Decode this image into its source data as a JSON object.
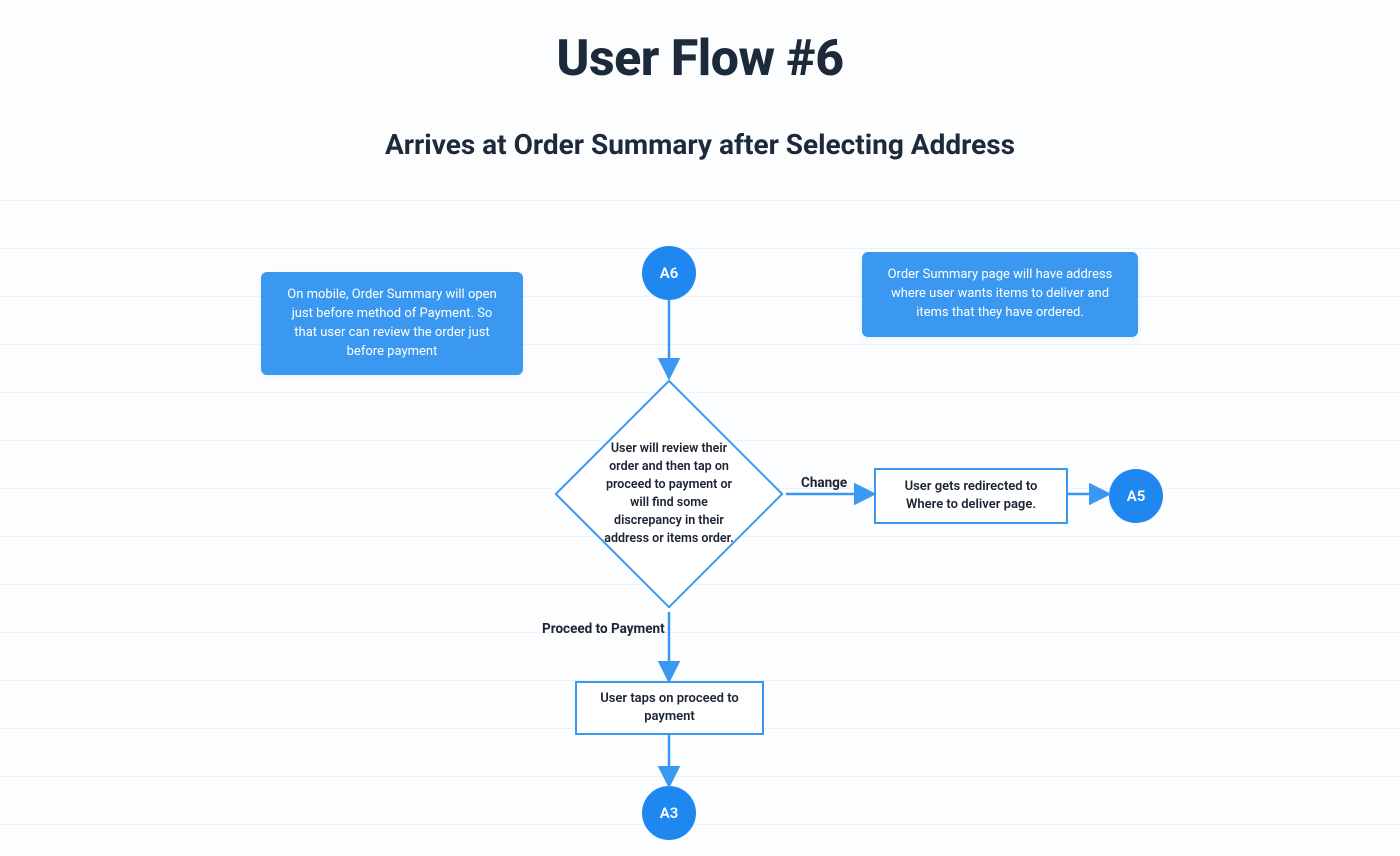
{
  "title": "User Flow #6",
  "subtitle": "Arrives at Order Summary after Selecting Address",
  "colors": {
    "accent": "#3a98f0",
    "circle": "#1e88f0",
    "text": "#1a2433"
  },
  "notes": {
    "left": "On mobile, Order Summary will open just before method of  Payment. So that user can review the order just before payment",
    "right": "Order Summary page will have address where user wants items to deliver and items that they have ordered."
  },
  "nodes": {
    "start": {
      "type": "circle",
      "label": "A6"
    },
    "decision": {
      "type": "diamond",
      "label": "User will review their order and then tap on proceed to payment or will find some discrepancy in their address or items order."
    },
    "redirect": {
      "type": "rect",
      "label": "User gets redirected to Where to deliver page."
    },
    "endRight": {
      "type": "circle",
      "label": "A5"
    },
    "proceed": {
      "type": "rect",
      "label": "User taps on proceed to payment"
    },
    "endDown": {
      "type": "circle",
      "label": "A3"
    }
  },
  "edges": {
    "change": "Change",
    "proceed": "Proceed to Payment"
  },
  "gridlines": [
    200,
    248,
    296,
    344,
    392,
    440,
    488,
    536,
    584,
    632,
    680,
    728,
    776,
    824
  ]
}
